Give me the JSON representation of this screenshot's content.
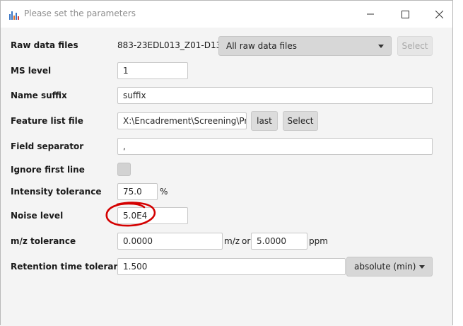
{
  "window": {
    "title": "Please set the parameters",
    "icon": "mzmine-chart-icon",
    "controls": [
      "minimize-icon",
      "maximize-icon",
      "close-icon"
    ]
  },
  "form": {
    "raw_data_files": {
      "label": "Raw data files",
      "value": "883-23EDL013_Z01-D13...",
      "dropdown": "All raw data files",
      "select": "Select"
    },
    "ms_level": {
      "label": "MS level",
      "value": "1"
    },
    "name_suffix": {
      "label": "Name suffix",
      "value": "suffix"
    },
    "feature_list_file": {
      "label": "Feature list file",
      "value": "X:\\Encadrement\\Screening\\Proje",
      "last": "last",
      "select": "Select"
    },
    "field_separator": {
      "label": "Field separator",
      "value": ","
    },
    "ignore_first_line": {
      "label": "Ignore first line",
      "checked": false
    },
    "intensity_tolerance": {
      "label": "Intensity tolerance",
      "value": "75.0",
      "unit": "%"
    },
    "noise_level": {
      "label": "Noise level",
      "value": "5.0E4"
    },
    "mz_tolerance": {
      "label": "m/z tolerance",
      "mz_value": "0.0000",
      "mz_unit": "m/z",
      "or": "or",
      "ppm_value": "5.0000",
      "ppm_unit": "ppm"
    },
    "rt_tolerance": {
      "label": "Retention time tolerance",
      "value": "1.500",
      "unit_dropdown": "absolute (min)"
    }
  },
  "annotation": {
    "shape": "red-ellipse-circle",
    "color": "#d40000"
  }
}
